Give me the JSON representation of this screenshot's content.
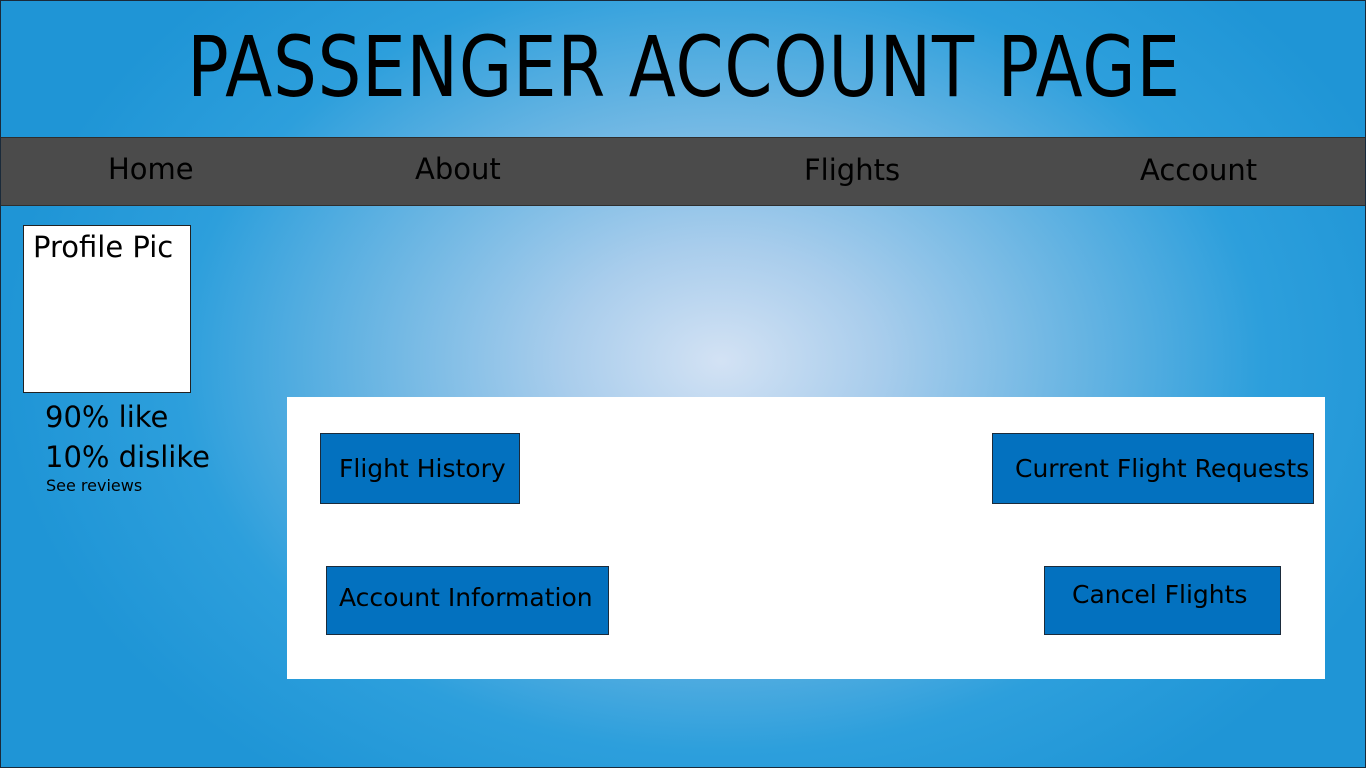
{
  "header": {
    "title": "PASSENGER ACCOUNT PAGE"
  },
  "nav": {
    "items": [
      {
        "label": "Home"
      },
      {
        "label": "About"
      },
      {
        "label": "Flights"
      },
      {
        "label": "Account"
      }
    ]
  },
  "profile": {
    "pic_label": "Profile Pic",
    "like": "90% like",
    "dislike": "10% dislike",
    "reviews_link": "See reviews"
  },
  "actions": {
    "flight_history": "Flight History",
    "current_requests": "Current Flight Requests",
    "account_information": "Account Information",
    "cancel_flights": "Cancel Flights"
  },
  "colors": {
    "background_outer": "#1f95d6",
    "background_center": "#d3e2f4",
    "navbar": "#4b4b4b",
    "button": "#0371bf",
    "panel": "#ffffff"
  }
}
